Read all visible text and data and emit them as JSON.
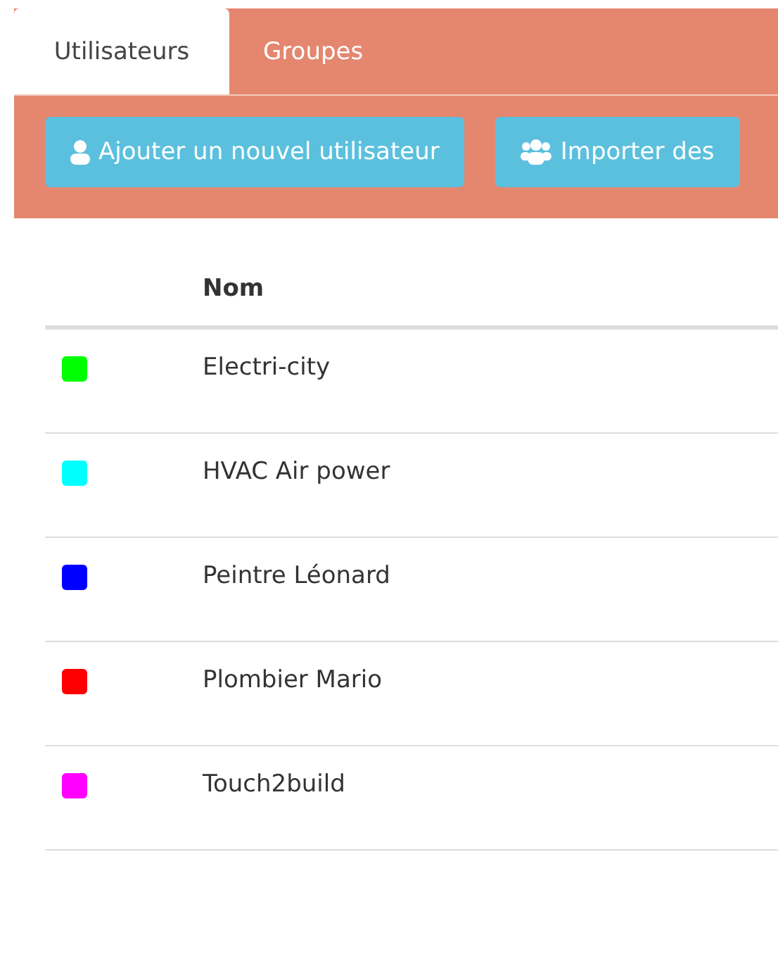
{
  "tabs": [
    {
      "label": "Utilisateurs",
      "selected": true
    },
    {
      "label": "Groupes",
      "selected": false
    }
  ],
  "toolbar": {
    "buttons": [
      {
        "label": "Ajouter un nouvel utilisateur",
        "kind": "user"
      },
      {
        "label": "Importer des",
        "kind": "users"
      }
    ]
  },
  "table": {
    "columns": [
      "Nom"
    ],
    "rows": [
      {
        "color": "#00ff00",
        "name": "Electri-city"
      },
      {
        "color": "#00ffff",
        "name": "HVAC Air power"
      },
      {
        "color": "#0000ff",
        "name": "Peintre Léonard"
      },
      {
        "color": "#ff0000",
        "name": "Plombier Mario"
      },
      {
        "color": "#ff00ff",
        "name": "Touch2build"
      }
    ]
  }
}
